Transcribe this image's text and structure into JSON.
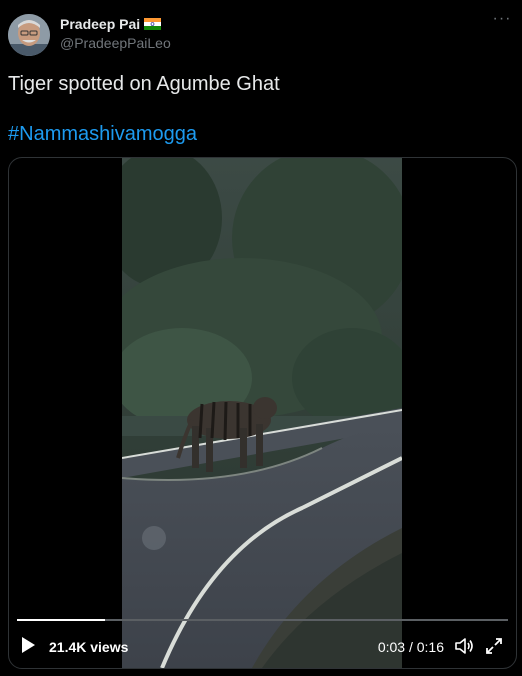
{
  "author": {
    "name": "Pradeep Pai",
    "handle": "@PradeepPaiLeo",
    "avatar_icon": "user-avatar-icon",
    "flag_icon": "india-flag-icon"
  },
  "more_label": "···",
  "tweet": {
    "text": "Tiger spotted on Agumbe Ghat",
    "hashtag": "#Nammashivamogga"
  },
  "video": {
    "views": "21.4K views",
    "time": "0:03 / 0:16",
    "progress": 0.18
  },
  "colors": {
    "background": "#000000",
    "text": "#e7e9ea",
    "secondary": "#71767b",
    "link": "#1d9bf0"
  }
}
